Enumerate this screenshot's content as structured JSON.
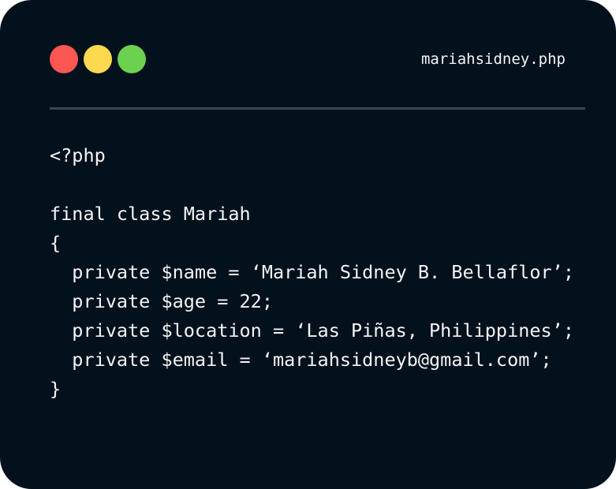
{
  "window": {
    "filename": "mariahsidney.php",
    "colors": {
      "background": "#03111d",
      "close": "#fc5753",
      "minimize": "#fcd94f",
      "maximize": "#6cd14f",
      "divider": "#3a4650",
      "text": "#f5f5f5"
    }
  },
  "code": {
    "lines": [
      "<?php",
      "",
      "final class Mariah",
      "{",
      "  private $name = ‘Mariah Sidney B. Bellaflor’;",
      "  private $age = 22;",
      "  private $location = ‘Las Piñas, Philippines’;",
      "  private $email = ‘mariahsidneyb@gmail.com’;",
      "}"
    ]
  }
}
